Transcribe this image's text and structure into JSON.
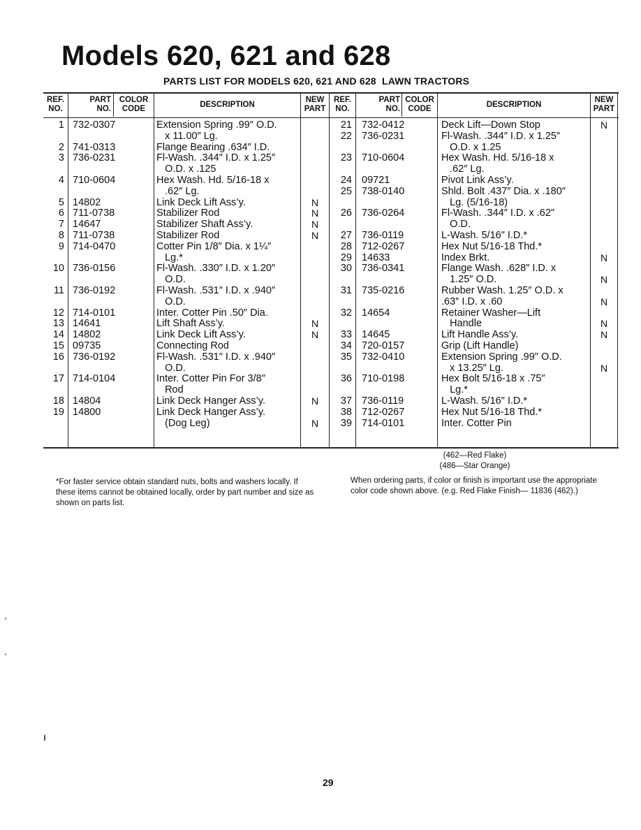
{
  "page": {
    "title": "Models 620, 621 and 628",
    "subtitle": "PARTS LIST FOR MODELS 620, 621 AND 628  LAWN TRACTORS",
    "page_number": "29"
  },
  "table": {
    "headers": {
      "ref_no": [
        "REF.",
        "NO."
      ],
      "part_no": [
        "PART",
        "NO."
      ],
      "color_code": [
        "COLOR",
        "CODE"
      ],
      "description": "DESCRIPTION",
      "new_part": [
        "NEW",
        "PART"
      ]
    },
    "left": {
      "lines": [
        {
          "ref": "1",
          "part": "732-0307",
          "desc": "Extension Spring .99″ O.D.",
          "new": ""
        },
        {
          "ref": "",
          "part": "",
          "desc": "   x 11.00″ Lg.",
          "new": ""
        },
        {
          "ref": "2",
          "part": "741-0313",
          "desc": "Flange Bearing .634″ I.D.",
          "new": ""
        },
        {
          "ref": "3",
          "part": "736-0231",
          "desc": "Fl-Wash. .344″ I.D. x 1.25″",
          "new": ""
        },
        {
          "ref": "",
          "part": "",
          "desc": "   O.D. x .125",
          "new": ""
        },
        {
          "ref": "4",
          "part": "710-0604",
          "desc": "Hex Wash. Hd. 5/16-18 x",
          "new": ""
        },
        {
          "ref": "",
          "part": "",
          "desc": "   .62″ Lg.",
          "new": ""
        },
        {
          "ref": "5",
          "part": "14802",
          "desc": "Link Deck Lift Ass’y.",
          "new": "N"
        },
        {
          "ref": "6",
          "part": "711-0738",
          "desc": "Stabilizer Rod",
          "new": "N"
        },
        {
          "ref": "7",
          "part": "14647",
          "desc": "Stabilizer Shaft Ass’y.",
          "new": "N"
        },
        {
          "ref": "8",
          "part": "711-0738",
          "desc": "Stabilizer Rod",
          "new": "N"
        },
        {
          "ref": "9",
          "part": "714-0470",
          "desc": "Cotter Pin 1/8″ Dia. x 1¼″",
          "new": ""
        },
        {
          "ref": "",
          "part": "",
          "desc": "   Lg.*",
          "new": ""
        },
        {
          "ref": "10",
          "part": "736-0156",
          "desc": "Fl-Wash. .330″ I.D. x 1.20″",
          "new": ""
        },
        {
          "ref": "",
          "part": "",
          "desc": "   O.D.",
          "new": ""
        },
        {
          "ref": "11",
          "part": "736-0192",
          "desc": "Fl-Wash. .531″ I.D. x .940″",
          "new": ""
        },
        {
          "ref": "",
          "part": "",
          "desc": "   O.D.",
          "new": ""
        },
        {
          "ref": "12",
          "part": "714-0101",
          "desc": "Inter. Cotter Pin .50″ Dia.",
          "new": ""
        },
        {
          "ref": "13",
          "part": "14641",
          "desc": "Lift Shaft Ass’y.",
          "new": "N"
        },
        {
          "ref": "14",
          "part": "14802",
          "desc": "Link Deck Lift Ass’y.",
          "new": "N"
        },
        {
          "ref": "15",
          "part": "09735",
          "desc": "Connecting Rod",
          "new": ""
        },
        {
          "ref": "16",
          "part": "736-0192",
          "desc": "Fl-Wash. .531″ I.D. x .940″",
          "new": ""
        },
        {
          "ref": "",
          "part": "",
          "desc": "   O.D.",
          "new": ""
        },
        {
          "ref": "17",
          "part": "714-0104",
          "desc": "Inter. Cotter Pin For 3/8″",
          "new": ""
        },
        {
          "ref": "",
          "part": "",
          "desc": "   Rod",
          "new": ""
        },
        {
          "ref": "18",
          "part": "14804",
          "desc": "Link Deck Hanger Ass’y.",
          "new": "N"
        },
        {
          "ref": "19",
          "part": "14800",
          "desc": "Link Deck Hanger Ass’y.",
          "new": ""
        },
        {
          "ref": "",
          "part": "",
          "desc": "   (Dog Leg)",
          "new": "N"
        }
      ]
    },
    "right": {
      "lines": [
        {
          "ref": "21",
          "part": "732-0412",
          "desc": "Deck Lift—Down Stop",
          "new": "N"
        },
        {
          "ref": "22",
          "part": "736-0231",
          "desc": "Fl-Wash. .344″ I.D. x 1.25″",
          "new": ""
        },
        {
          "ref": "",
          "part": "",
          "desc": "   O.D. x 1.25",
          "new": ""
        },
        {
          "ref": "23",
          "part": "710-0604",
          "desc": "Hex Wash. Hd. 5/16-18 x",
          "new": ""
        },
        {
          "ref": "",
          "part": "",
          "desc": "   .62″ Lg.",
          "new": ""
        },
        {
          "ref": "24",
          "part": "09721",
          "desc": "Pivot Link Ass’y.",
          "new": ""
        },
        {
          "ref": "25",
          "part": "738-0140",
          "desc": "Shld. Bolt .437″ Dia. x .180″",
          "new": ""
        },
        {
          "ref": "",
          "part": "",
          "desc": "   Lg. (5/16-18)",
          "new": ""
        },
        {
          "ref": "26",
          "part": "736-0264",
          "desc": "Fl-Wash. .344″ I.D. x .62″",
          "new": ""
        },
        {
          "ref": "",
          "part": "",
          "desc": "   O.D.",
          "new": ""
        },
        {
          "ref": "27",
          "part": "736-0119",
          "desc": "L-Wash. 5/16″ I.D.*",
          "new": ""
        },
        {
          "ref": "28",
          "part": "712-0267",
          "desc": "Hex Nut 5/16-18 Thd.*",
          "new": ""
        },
        {
          "ref": "29",
          "part": "14633",
          "desc": "Index Brkt.",
          "new": "N"
        },
        {
          "ref": "30",
          "part": "736-0341",
          "desc": "Flange Wash. .628″ I.D. x",
          "new": ""
        },
        {
          "ref": "",
          "part": "",
          "desc": "   1.25″ O.D.",
          "new": "N"
        },
        {
          "ref": "31",
          "part": "735-0216",
          "desc": "Rubber Wash. 1.25″ O.D. x",
          "new": ""
        },
        {
          "ref": "",
          "part": "",
          "desc": ".63″ I.D. x .60",
          "new": "N"
        },
        {
          "ref": "32",
          "part": "14654",
          "desc": "Retainer Washer—Lift",
          "new": ""
        },
        {
          "ref": "",
          "part": "",
          "desc": "   Handle",
          "new": "N"
        },
        {
          "ref": "33",
          "part": "14645",
          "desc": "Lift Handle Ass’y.",
          "new": "N"
        },
        {
          "ref": "34",
          "part": "720-0157",
          "desc": "Grip (Lift Handle)",
          "new": ""
        },
        {
          "ref": "35",
          "part": "732-0410",
          "desc": "Extension Spring .99″ O.D.",
          "new": ""
        },
        {
          "ref": "",
          "part": "",
          "desc": "   x 13.25″ Lg.",
          "new": "N"
        },
        {
          "ref": "36",
          "part": "710-0198",
          "desc": "Hex Bolt 5/16-18 x .75″",
          "new": ""
        },
        {
          "ref": "",
          "part": "",
          "desc": "   Lg.*",
          "new": ""
        },
        {
          "ref": "37",
          "part": "736-0119",
          "desc": "L-Wash. 5/16″ I.D.*",
          "new": ""
        },
        {
          "ref": "38",
          "part": "712-0267",
          "desc": "Hex Nut 5/16-18 Thd.*",
          "new": ""
        },
        {
          "ref": "39",
          "part": "714-0101",
          "desc": "Inter. Cotter Pin",
          "new": ""
        }
      ]
    }
  },
  "notes": {
    "color_codes": [
      "(462—Red Flake)",
      "(486—Star Orange)"
    ],
    "footnote": "*For faster service obtain standard nuts, bolts and washers locally. If these items cannot be obtained locally, order by part number and size as shown on parts list.",
    "ordering": "When ordering parts, if color or finish is important use the appropriate color code shown above. (e.g. Red Flake Finish— 11836 (462).)"
  }
}
